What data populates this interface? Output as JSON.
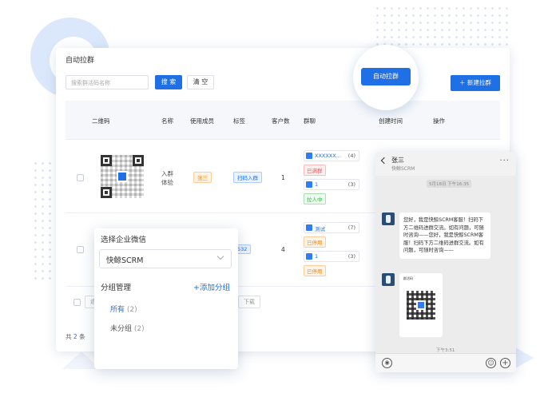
{
  "page": {
    "title": "自动拉群",
    "search_placeholder": "搜索群活码名称",
    "search_label": "搜 索",
    "clear_label": "清 空",
    "new_button_label": "＋ 新建拉群",
    "auto_group_button_label": "自动拉群"
  },
  "table": {
    "headers": {
      "qr": "二维码",
      "name": "名称",
      "members": "使用成员",
      "tags": "标签",
      "customers": "客户数",
      "groups": "群聊",
      "created": "创建时间",
      "actions": "操作"
    },
    "rows": [
      {
        "name_line1": "入群",
        "name_line2": "体验",
        "member": "张三",
        "tag": "扫码入群",
        "customers": "1",
        "groups": [
          {
            "name": "XXXXXX...",
            "count": "(4)",
            "status": "已满群",
            "status_color": "#f0505a"
          },
          {
            "name": "1",
            "count": "(3)",
            "status": "拉人中",
            "status_color": "#3ab34a"
          }
        ]
      },
      {
        "tag": "532",
        "customers": "4",
        "groups": [
          {
            "name": "测试",
            "count": "(7)",
            "status": "已停用",
            "status_color": "#f08a24"
          },
          {
            "name": "1",
            "count": "(3)",
            "status": "已停用",
            "status_color": "#f08a24"
          }
        ]
      }
    ],
    "batch_buttons": [
      "退",
      "下载"
    ],
    "total_prefix": "共",
    "total_count": "2",
    "total_suffix": "条"
  },
  "dropdown": {
    "select_label": "选择企业微信",
    "select_value": "快鲸SCRM",
    "group_manage_label": "分组管理",
    "add_group_label": "+添加分组",
    "items": [
      {
        "label": "所有",
        "count": "(2)"
      },
      {
        "label": "未分组",
        "count": "(2)"
      }
    ]
  },
  "phone": {
    "contact_name": "张三",
    "contact_sub": "快鲸SCRM",
    "timestamp": "5月18日 下午16:35",
    "message": "您好，我是快鲸SCRM客服！扫码下方二维码进群交流。如有问题，可随时咨询——您好，我是快鲸SCRM客服！扫码下方二维码进群交流。如有问题，可随时咨询——",
    "card_title": "群活码",
    "bottom_time": "下午3:51"
  },
  "colors": {
    "accent": "#1f6fe5"
  }
}
